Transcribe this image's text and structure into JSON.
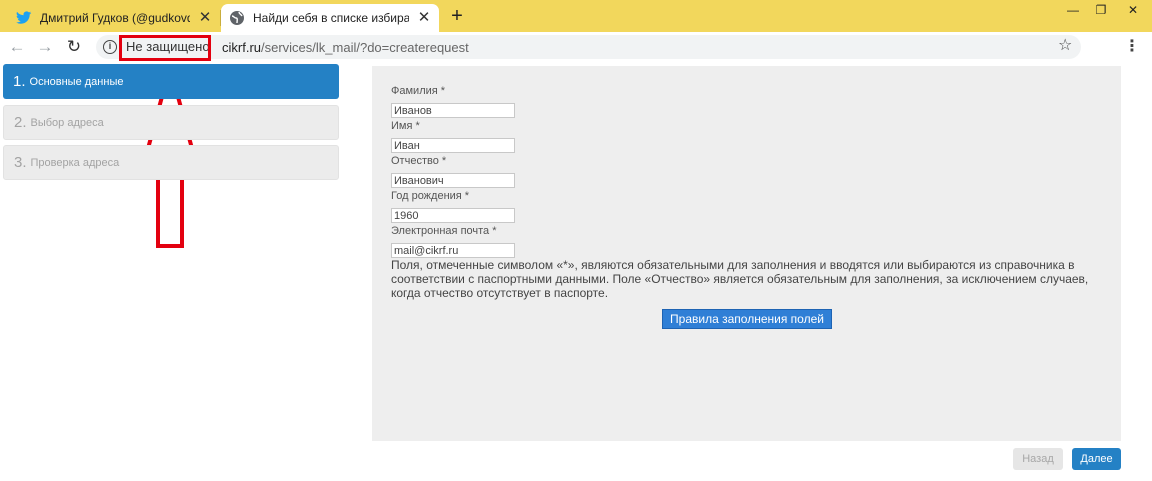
{
  "browser": {
    "tabs": [
      {
        "title": "Дмитрий Гудков (@gudkovd) | Twitter",
        "icon": "twitter-bird-icon",
        "active": false
      },
      {
        "title": "Найди себя в списке избирателей",
        "icon": "globe-icon",
        "active": true
      }
    ],
    "security_label": "Не защищено",
    "url_host": "cikrf.ru",
    "url_path": "/services/lk_mail/?do=createrequest"
  },
  "steps": [
    {
      "number": "1.",
      "label": "Основные данные",
      "active": true
    },
    {
      "number": "2.",
      "label": "Выбор адреса",
      "active": false
    },
    {
      "number": "3.",
      "label": "Проверка адреса",
      "active": false
    }
  ],
  "form": {
    "fields": [
      {
        "label": "Фамилия *",
        "value": "Иванов"
      },
      {
        "label": "Имя *",
        "value": "Иван"
      },
      {
        "label": "Отчество *",
        "value": "Иванович"
      },
      {
        "label": "Год рождения *",
        "value": "1960"
      },
      {
        "label": "Электронная почта *",
        "value": "mail@cikrf.ru"
      }
    ],
    "note": "Поля, отмеченные символом «*», являются обязательными для заполнения и вводятся или выбираются из справочника в соответствии с паспортными данными. Поле «Отчество» является обязательным для заполнения, за исключением случаев, когда отчество отсутствует в паспорте.",
    "rules_button": "Правила заполнения полей"
  },
  "nav": {
    "back_label": "Назад",
    "next_label": "Далее"
  },
  "colors": {
    "tabstrip": "#f2d75c",
    "accent": "#2481c5",
    "annotation": "#e3000f"
  }
}
